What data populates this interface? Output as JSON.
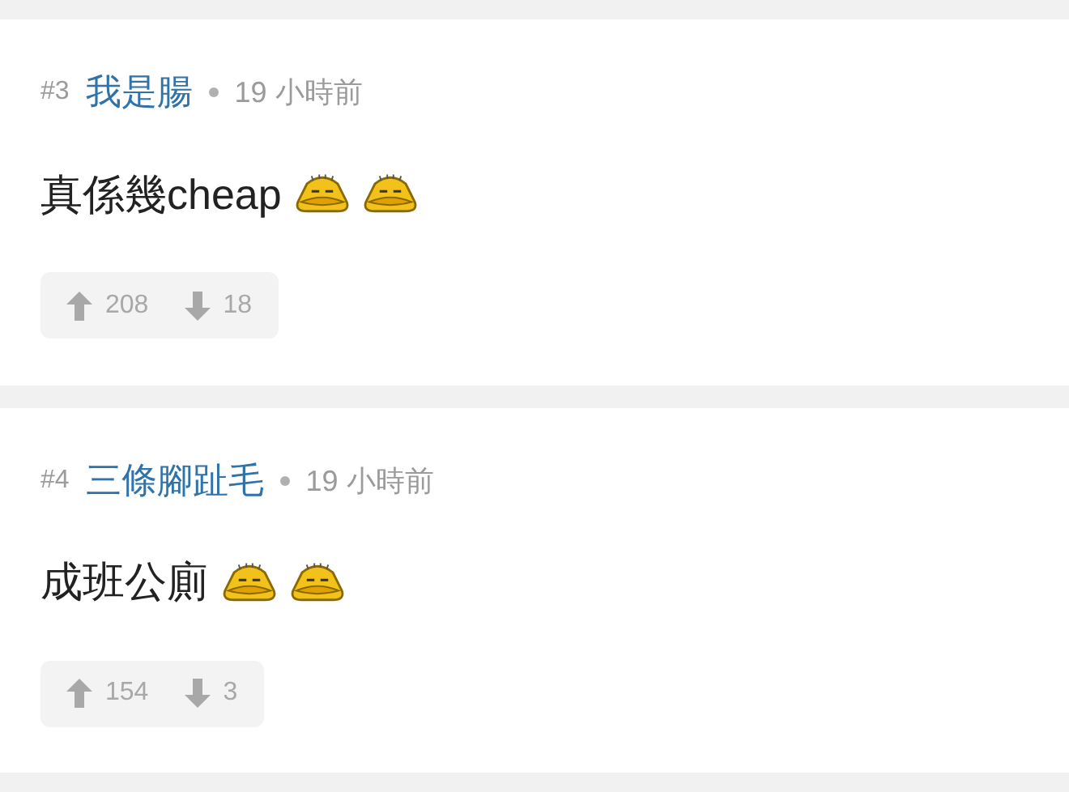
{
  "comments": [
    {
      "number": "#3",
      "author": "我是腸",
      "time": "19 小時前",
      "body": [
        {
          "kind": "text",
          "text": "真係幾cheap"
        },
        {
          "kind": "emoticon"
        },
        {
          "kind": "emoticon"
        }
      ],
      "upvotes": "208",
      "downvotes": "18"
    },
    {
      "number": "#4",
      "author": "三條腳趾毛",
      "time": "19 小時前",
      "body": [
        {
          "kind": "text",
          "text": "成班公廁"
        },
        {
          "kind": "emoticon"
        },
        {
          "kind": "emoticon"
        }
      ],
      "upvotes": "154",
      "downvotes": "3"
    }
  ]
}
